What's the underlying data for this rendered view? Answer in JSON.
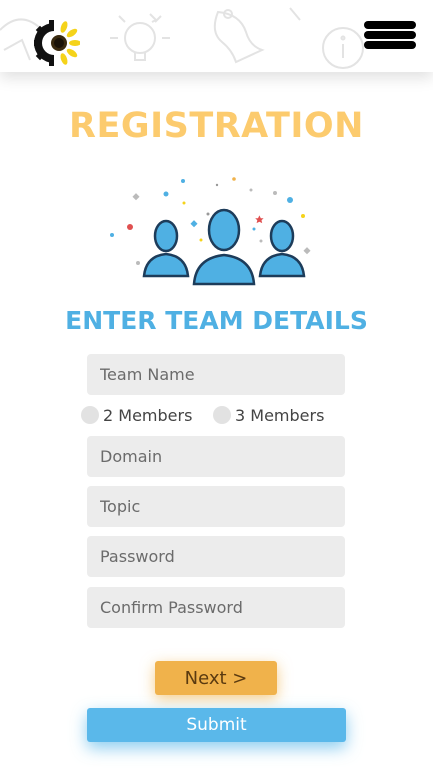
{
  "header": {
    "menu_icon": "hamburger-menu-icon",
    "logo_icon": "sunflower-gear-logo"
  },
  "page": {
    "title": "REGISTRATION",
    "subtitle": "ENTER TEAM DETAILS"
  },
  "form": {
    "team_name": {
      "placeholder": "Team Name",
      "value": ""
    },
    "member_options": [
      {
        "label": "2 Members",
        "selected": false
      },
      {
        "label": "3 Members",
        "selected": false
      }
    ],
    "domain": {
      "placeholder": "Domain",
      "value": ""
    },
    "topic": {
      "placeholder": "Topic",
      "value": ""
    },
    "password": {
      "placeholder": "Password",
      "value": ""
    },
    "confirm_password": {
      "placeholder": "Confirm Password",
      "value": ""
    }
  },
  "buttons": {
    "next_label": "Next >",
    "submit_label": "Submit"
  },
  "colors": {
    "title": "#fccb6e",
    "subtitle": "#4fb0e3",
    "next_button": "#f0b24b",
    "submit_button": "#5ab8ea",
    "field_background": "#ececec"
  }
}
